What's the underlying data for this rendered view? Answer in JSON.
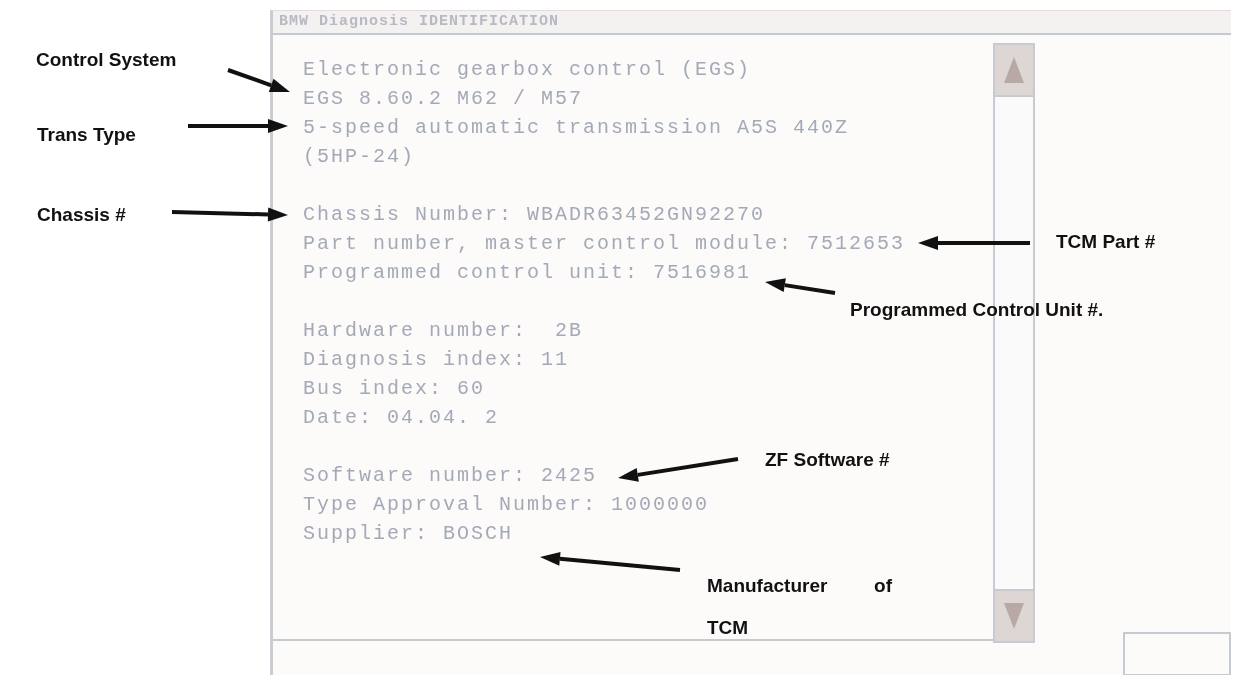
{
  "window": {
    "title": "BMW Diagnosis IDENTIFICATION"
  },
  "groups": [
    [
      "Electronic gearbox control (EGS)",
      "EGS 8.60.2 M62 / M57",
      "5-speed automatic transmission A5S 440Z",
      "(5HP-24)"
    ],
    [
      "Chassis Number: WBADR63452GN92270",
      "Part number, master control module: 7512653",
      "Programmed control unit: 7516981"
    ],
    [
      "Hardware number:  2B",
      "Diagnosis index: 11",
      "Bus index: 60",
      "Date: 04.04. 2"
    ],
    [
      "Software number: 2425",
      "Type Approval Number: 1000000",
      "Supplier: BOSCH"
    ]
  ],
  "annotations": [
    {
      "text": "Control System"
    },
    {
      "text": "Trans Type"
    },
    {
      "text": "Chassis #"
    },
    {
      "text": "TCM Part #"
    },
    {
      "text": "Programmed Control Unit #."
    },
    {
      "text": "ZF Software #"
    },
    {
      "text": "Manufacturer of TCM"
    }
  ]
}
